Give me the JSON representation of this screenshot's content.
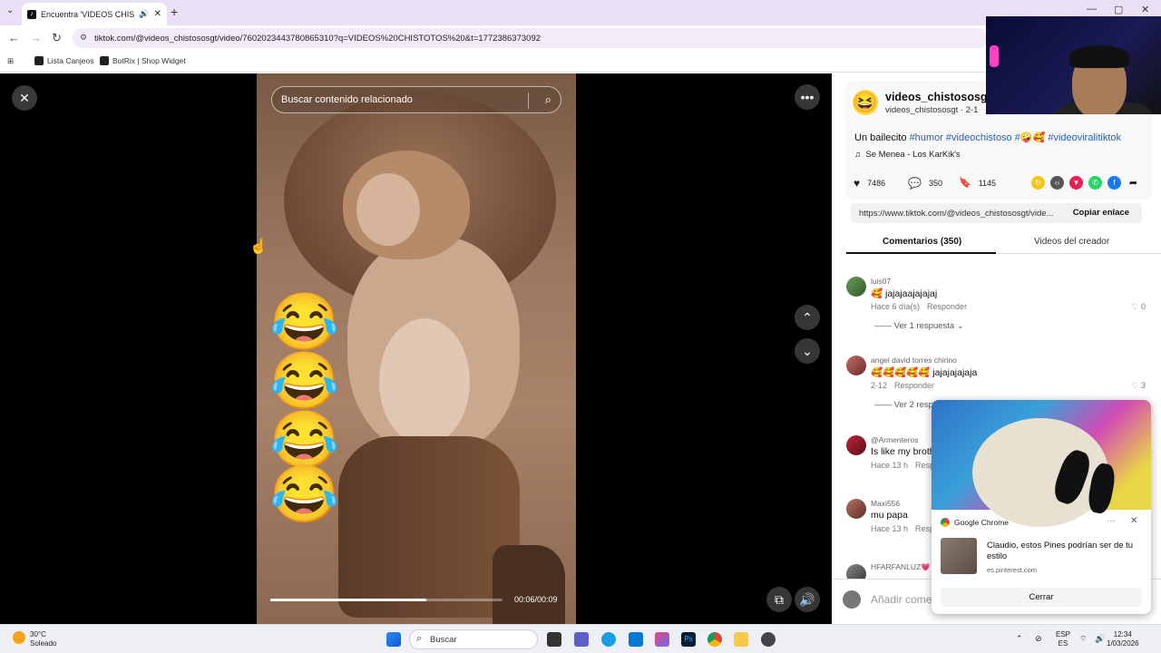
{
  "browser": {
    "tab_title": "Encuentra 'VIDEOS CHISTO",
    "tab_audio_icon": "speaker-icon",
    "new_tab": "+",
    "url": "tiktok.com/@videos_chistososgt/video/7602023443780865310?q=VIDEOS%20CHISTOTOS%20&t=1772386373092",
    "bookmarks": [
      "Lista Canjeos",
      "BotRix | Shop Widget"
    ]
  },
  "video": {
    "search_placeholder": "Buscar contenido relacionado",
    "time": "00:06/00:09",
    "progress": 0.67,
    "emojis": [
      "😂",
      "😂",
      "😂",
      "😂"
    ]
  },
  "post": {
    "username": "videos_chistososgt",
    "subline": "videos_chistososgt · 2-1",
    "caption_text": "Un bailecito",
    "hashtags": [
      "#humor",
      "#videochistoso",
      "#🤪🥰",
      "#videoviralitiktok"
    ],
    "music": "Se Menea - Los KarKik's",
    "likes": "7486",
    "comments_count": "350",
    "saves": "1145",
    "link": "https://www.tiktok.com/@videos_chistososgt/vide...",
    "copy_label": "Copiar enlace",
    "tab_comments": "Comentarios (350)",
    "tab_creator": "Videos del creador",
    "add_comment_placeholder": "Añadir come"
  },
  "comments": [
    {
      "user": "luis07",
      "text": "🥰 jajajaajajajaj",
      "time": "Hace 6 día(s)",
      "reply": "Responder",
      "likes": "0",
      "replies": "Ver 1 respuesta"
    },
    {
      "user": "angel david torres chirino",
      "text": "🥰🥰🥰🥰🥰 jajajajajaja",
      "time": "2-12",
      "reply": "Responder",
      "likes": "3",
      "replies": "Ver 2 resp"
    },
    {
      "user": "@Armenteros",
      "text": "Is like my broth",
      "time": "Hace 13 h",
      "reply": "Resp",
      "likes": "",
      "replies": ""
    },
    {
      "user": "Maxi556",
      "text": "mu papa",
      "time": "Hace 13 h",
      "reply": "Resp",
      "likes": "",
      "replies": ""
    },
    {
      "user": "HFARFANLUZ💗",
      "text": "",
      "time": "",
      "reply": "",
      "likes": "",
      "replies": ""
    }
  ],
  "notification": {
    "app": "Google Chrome",
    "message": "Claudio, estos Pines podrían ser de tu estilo",
    "source": "es.pinterest.com",
    "button": "Cerrar"
  },
  "taskbar": {
    "temperature": "30°C",
    "weather": "Soleado",
    "search_placeholder": "Buscar",
    "lang_top": "ESP",
    "lang_bottom": "ES",
    "time": "12:34",
    "date": "1/03/2026"
  },
  "colors": {
    "hashtag": "#2b5fa8",
    "tab_strip": "#e9e0f5"
  }
}
